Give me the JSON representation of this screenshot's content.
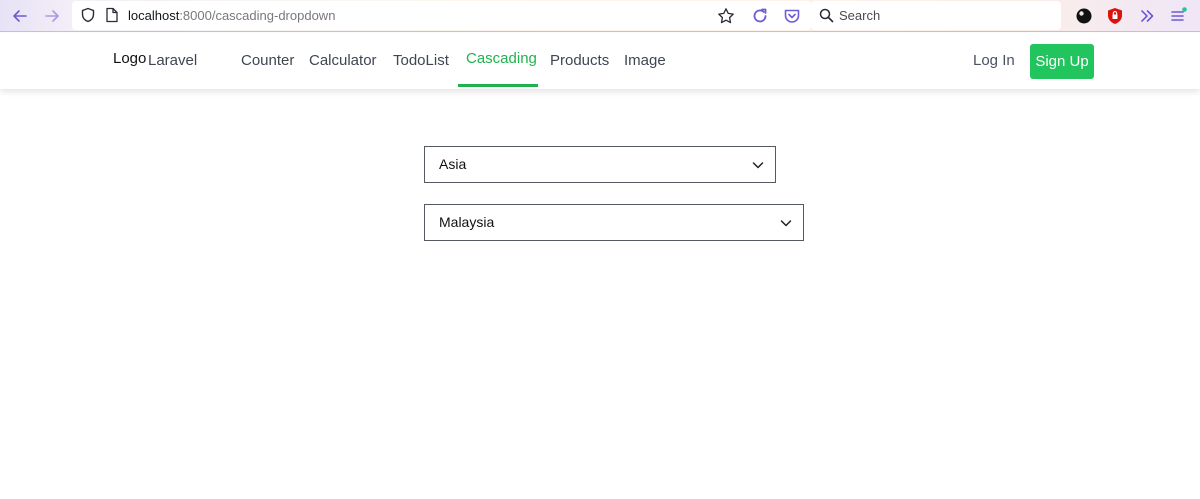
{
  "browser": {
    "url_host": "localhost",
    "url_rest": ":8000/cascading-dropdown",
    "search_placeholder": "Search"
  },
  "navbar": {
    "logo": "Logo",
    "brand": "Laravel",
    "links": [
      "Counter",
      "Calculator",
      "TodoList",
      "Cascading",
      "Products",
      "Image"
    ],
    "active_index": 3,
    "login": "Log In",
    "signup": "Sign Up",
    "accent_color": "#21b24f"
  },
  "form": {
    "continent_value": "Asia",
    "country_value": "Malaysia"
  }
}
